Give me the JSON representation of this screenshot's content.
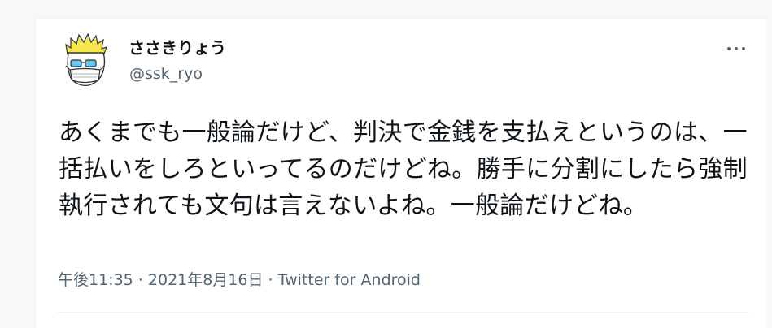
{
  "tweet": {
    "author_name": "ささきりょう",
    "author_handle": "@ssk_ryo",
    "more_icon": "more-horizontal-icon",
    "text": "あくまでも一般論だけど、判決で金銭を支払えというのは、一括払いをしろといってるのだけどね。勝手に分割にしたら強制執行されても文句は言えないよね。一般論だけどね。",
    "time": "午後11:35",
    "separator1": " · ",
    "date": "2021年8月16日",
    "separator2": " · ",
    "source": "Twitter for Android"
  },
  "colors": {
    "text_primary": "#0f1419",
    "text_secondary": "#536471",
    "background": "#ffffff",
    "border": "#eff3f4"
  }
}
